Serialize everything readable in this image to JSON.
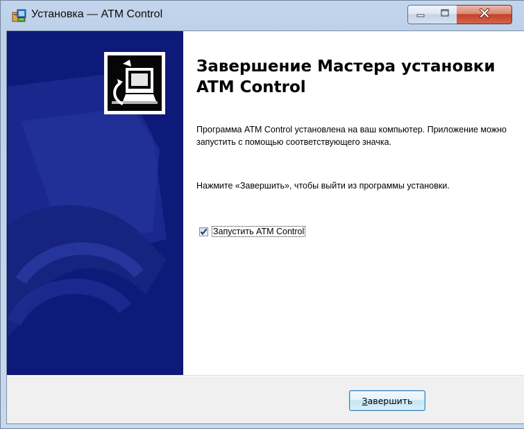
{
  "window": {
    "title": "Установка — ATM Control",
    "app_icon": "setup-installer-icon"
  },
  "caption_buttons": {
    "minimize_icon": "minimize-icon",
    "maximize_icon": "maximize-icon",
    "close_icon": "close-icon"
  },
  "wizard": {
    "heading": "Завершение Мастера установки ATM Control",
    "paragraph1": "Программа ATM Control установлена на ваш компьютер. Приложение можно запустить с помощью соответствующего значка.",
    "paragraph2": "Нажмите «Завершить», чтобы выйти из программы установки.",
    "launch_checkbox": {
      "label": "Запустить ATM Control",
      "checked": true
    },
    "logo_icon": "computer-install-icon"
  },
  "footer": {
    "finish_accel": "З",
    "finish_rest": "авершить"
  },
  "colors": {
    "banner": "#0d1a7a",
    "content_bg": "#ffffff",
    "dialog_bg": "#f0f0f0",
    "close_button": "#c6412a"
  }
}
